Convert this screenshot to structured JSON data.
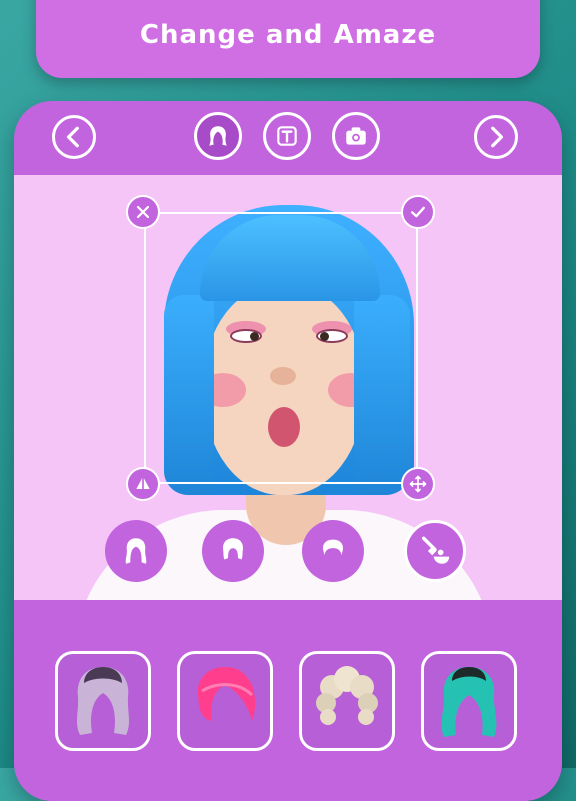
{
  "banner": {
    "title": "Change and Amaze"
  },
  "toolbar": {
    "left_icon": "chevron-left-icon",
    "right_icon": "chevron-right-icon",
    "tools": [
      "hair-tool-icon",
      "text-tool-icon",
      "camera-icon"
    ],
    "active_tool": "hair-tool-icon"
  },
  "editor": {
    "frame_actions": [
      "close-icon",
      "check-icon",
      "flip-icon",
      "move-icon"
    ],
    "style_options": [
      "long-hair-icon",
      "medium-hair-icon",
      "short-hair-icon",
      "hair-dye-icon"
    ],
    "selected_style": "hair-dye-icon"
  },
  "wig_gallery": [
    {
      "name": "lavender-wig",
      "color": "#c9b4d8"
    },
    {
      "name": "pink-wig",
      "color": "#ff3f8e"
    },
    {
      "name": "blonde-curly-wig",
      "color": "#e8dcc6"
    },
    {
      "name": "teal-wig",
      "color": "#25c2b3"
    }
  ],
  "colors": {
    "accent": "#c264de",
    "stage": "#f6c5f8",
    "wig_blue": "#3fb0ff"
  }
}
